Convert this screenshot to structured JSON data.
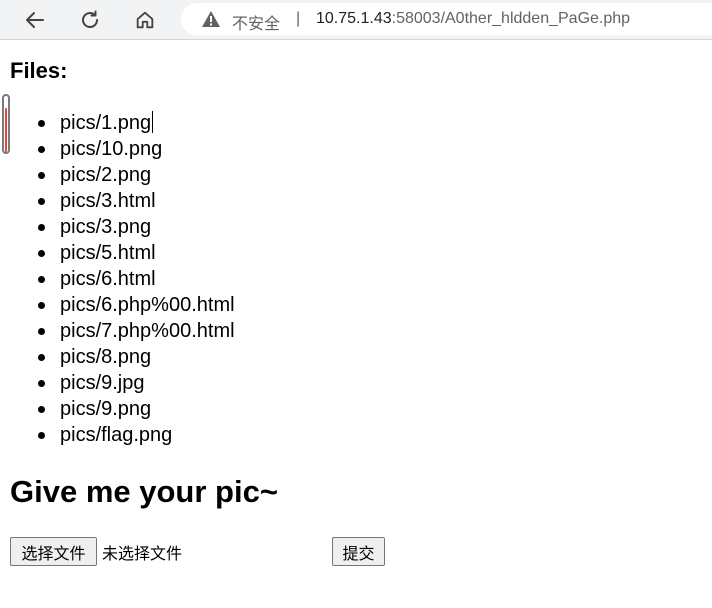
{
  "browser": {
    "security_label": "不安全",
    "separator": "|",
    "url_host": "10.75.1.43",
    "url_rest": ":58003/A0ther_hldden_PaGe.php",
    "icons": [
      "back-arrow-icon",
      "reload-icon",
      "home-icon",
      "warning-triangle-icon"
    ]
  },
  "page": {
    "files_heading": "Files:",
    "files": [
      "pics/1.png",
      "pics/10.png",
      "pics/2.png",
      "pics/3.html",
      "pics/3.png",
      "pics/5.html",
      "pics/6.html",
      "pics/6.php%00.html",
      "pics/7.php%00.html",
      "pics/8.png",
      "pics/9.jpg",
      "pics/9.png",
      "pics/flag.png"
    ],
    "upload_heading": "Give me your pic~",
    "choose_file_label": "选择文件",
    "no_file_label": "未选择文件",
    "submit_label": "提交"
  },
  "colors": {
    "toolbar_bg": "#f1f3f4",
    "scroll_accent": "#e0443a"
  }
}
